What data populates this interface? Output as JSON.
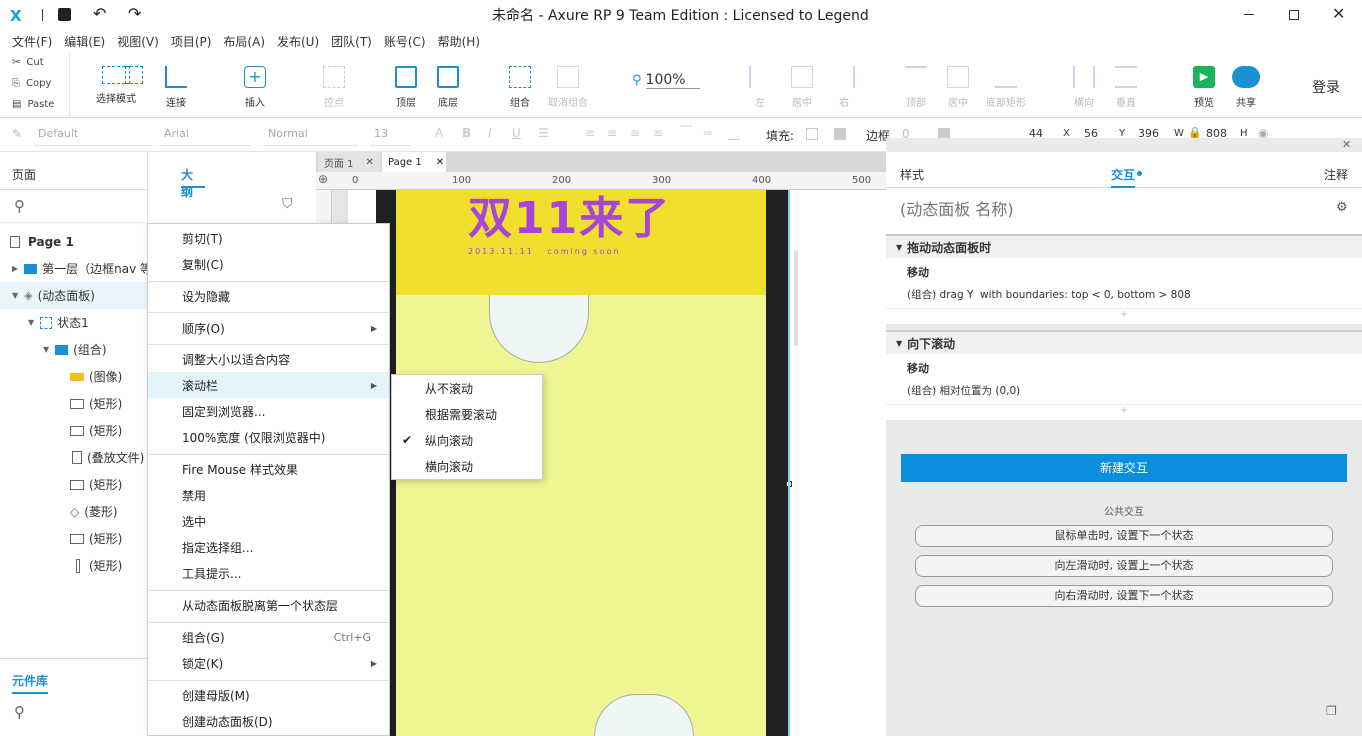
{
  "titlebar": {
    "title": "未命名 - Axure RP 9 Team Edition : Licensed to Legend"
  },
  "menu": [
    "文件(F)",
    "编辑(E)",
    "视图(V)",
    "项目(P)",
    "布局(A)",
    "发布(U)",
    "团队(T)",
    "账号(C)",
    "帮助(H)"
  ],
  "clipboard": {
    "cut": "Cut",
    "copy": "Copy",
    "paste": "Paste"
  },
  "toolbar": {
    "select_mode": "选择模式",
    "connect": "连接",
    "insert": "插入",
    "point": "控点",
    "top": "顶层",
    "bottom": "底层",
    "group": "组合",
    "ungroup": "取消组合",
    "zoom": "100%",
    "left": "左",
    "center": "居中",
    "right": "右",
    "top_align": "顶部",
    "middle": "居中",
    "bottom_align": "底部矩形",
    "horizontal": "横向",
    "vertical": "垂直",
    "preview": "预览",
    "share": "共享",
    "login": "登录"
  },
  "formatbar": {
    "style": "Default",
    "font": "Arial",
    "weight": "Normal",
    "size": "13",
    "fill_label": "填充:",
    "border_label": "边框",
    "border_value": "0",
    "x": "44",
    "x_label": "X",
    "y": "56",
    "y_label": "Y",
    "w": "396",
    "w_label": "W",
    "h": "808",
    "h_label": "H"
  },
  "leftpanel": {
    "tab_pages": "页面",
    "tab_outline": "大纲",
    "tab_library": "元件库",
    "tree": [
      {
        "label": "Page 1"
      },
      {
        "label": "第一层（边框nav 等"
      },
      {
        "label": "(动态面板)"
      },
      {
        "label": "状态1"
      },
      {
        "label": "(组合)"
      },
      {
        "label": "(图像)"
      },
      {
        "label": "(矩形)"
      },
      {
        "label": "(矩形)"
      },
      {
        "label": "(叠放文件)"
      },
      {
        "label": "(矩形)"
      },
      {
        "label": "(菱形)"
      },
      {
        "label": "(矩形)"
      },
      {
        "label": "(矩形)"
      }
    ]
  },
  "canvas": {
    "tabs": [
      "页面 1",
      "Page 1"
    ],
    "ruler": [
      "0",
      "100",
      "200",
      "300",
      "400",
      "500"
    ],
    "banner_text": "双11来了",
    "banner_date": "2013.11.11   coming soon"
  },
  "context_menu": [
    {
      "label": "剪切(T)"
    },
    {
      "label": "复制(C)"
    },
    {
      "label": "设为隐藏"
    },
    {
      "label": "顺序(O)"
    },
    {
      "label": "调整大小以适合内容"
    },
    {
      "label": "滚动栏"
    },
    {
      "label": "固定到浏览器..."
    },
    {
      "label": "100%宽度 (仅限浏览器中)"
    },
    {
      "label": "Fire Mouse 样式效果"
    },
    {
      "label": "禁用"
    },
    {
      "label": "选中"
    },
    {
      "label": "指定选择组..."
    },
    {
      "label": "工具提示..."
    },
    {
      "label": "从动态面板脱离第一个状态层"
    },
    {
      "label": "组合(G)",
      "shortcut": "Ctrl+G"
    },
    {
      "label": "锁定(K)"
    },
    {
      "label": "创建母版(M)"
    },
    {
      "label": "创建动态面板(D)"
    }
  ],
  "submenu": [
    {
      "label": "从不滚动"
    },
    {
      "label": "根据需要滚动"
    },
    {
      "label": "纵向滚动",
      "checked": true
    },
    {
      "label": "横向滚动"
    }
  ],
  "rightpanel": {
    "tab_style": "样式",
    "tab_interact": "交互",
    "tab_notes": "注释",
    "panel_name_placeholder": "(动态面板 名称)",
    "events": [
      {
        "title": "拖动动态面板时",
        "action": "移动",
        "detail": "(组合) drag Y  with boundaries: top < 0, bottom > 808"
      },
      {
        "title": "向下滚动",
        "action": "移动",
        "detail": "(组合) 相对位置为 (0,0)"
      }
    ],
    "new_interaction": "新建交互",
    "common_label": "公共交互",
    "common": [
      "鼠标单击时, 设置下一个状态",
      "向左滑动时, 设置上一个状态",
      "向右滑动时, 设置下一个状态"
    ],
    "plus": "+"
  },
  "colors": {
    "accent": "#0a8fdc",
    "banner_yellow": "#f0df2c",
    "canvas_yellow": "#eef592",
    "purple": "#a646d9"
  }
}
